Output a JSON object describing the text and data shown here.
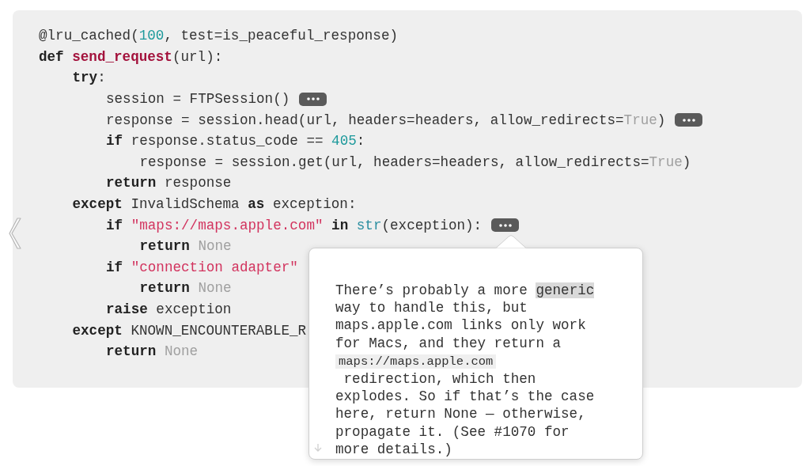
{
  "code": {
    "lines": [
      {
        "tokens": [
          {
            "kind": "plain",
            "text": "@lru_cached("
          },
          {
            "kind": "number",
            "text": "100"
          },
          {
            "kind": "plain",
            "text": ", test=is_peaceful_response)"
          }
        ],
        "has_more": false
      },
      {
        "tokens": [
          {
            "kind": "keyword",
            "text": "def "
          },
          {
            "kind": "function",
            "text": "send_request"
          },
          {
            "kind": "plain",
            "text": "(url):"
          }
        ],
        "has_more": false,
        "children": [
          {
            "tokens": [
              {
                "kind": "keyword",
                "text": "try"
              },
              {
                "kind": "plain",
                "text": ":"
              }
            ],
            "has_more": false,
            "children": [
              {
                "tokens": [
                  {
                    "kind": "plain",
                    "text": "session = FTPSession()"
                  }
                ],
                "has_more": true
              },
              {
                "tokens": [
                  {
                    "kind": "plain",
                    "text": "response = session.head(url, headers=headers, allow_redirects="
                  },
                  {
                    "kind": "constant",
                    "text": "True"
                  },
                  {
                    "kind": "plain",
                    "text": ")"
                  }
                ],
                "has_more": true
              },
              {
                "tokens": [
                  {
                    "kind": "keyword",
                    "text": "if "
                  },
                  {
                    "kind": "plain",
                    "text": "response.status_code == "
                  },
                  {
                    "kind": "number",
                    "text": "405"
                  },
                  {
                    "kind": "plain",
                    "text": ":"
                  }
                ],
                "has_more": false,
                "children": [
                  {
                    "tokens": [
                      {
                        "kind": "plain",
                        "text": "response = session.get(url, headers=headers, allow_redirects="
                      },
                      {
                        "kind": "constant",
                        "text": "True"
                      },
                      {
                        "kind": "plain",
                        "text": ")"
                      }
                    ],
                    "has_more": false
                  }
                ]
              },
              {
                "tokens": [
                  {
                    "kind": "keyword",
                    "text": "return "
                  },
                  {
                    "kind": "plain",
                    "text": "response"
                  }
                ],
                "has_more": false
              }
            ]
          },
          {
            "tokens": [
              {
                "kind": "keyword",
                "text": "except "
              },
              {
                "kind": "plain",
                "text": "InvalidSchema "
              },
              {
                "kind": "keyword",
                "text": "as "
              },
              {
                "kind": "plain",
                "text": "exception:"
              }
            ],
            "has_more": false,
            "children": [
              {
                "tokens": [
                  {
                    "kind": "keyword",
                    "text": "if "
                  },
                  {
                    "kind": "string",
                    "text": "\"maps://maps.apple.com\""
                  },
                  {
                    "kind": "keyword",
                    "text": " in "
                  },
                  {
                    "kind": "builtin",
                    "text": "str"
                  },
                  {
                    "kind": "plain",
                    "text": "(exception):"
                  }
                ],
                "has_more": true,
                "children": [
                  {
                    "tokens": [
                      {
                        "kind": "keyword",
                        "text": "return "
                      },
                      {
                        "kind": "constant",
                        "text": "None"
                      }
                    ],
                    "has_more": false
                  }
                ]
              },
              {
                "tokens": [
                  {
                    "kind": "keyword",
                    "text": "if "
                  },
                  {
                    "kind": "string",
                    "text": "\"connection adapter\""
                  }
                ],
                "has_more": false,
                "children": [
                  {
                    "tokens": [
                      {
                        "kind": "keyword",
                        "text": "return "
                      },
                      {
                        "kind": "constant",
                        "text": "None"
                      }
                    ],
                    "has_more": false
                  }
                ]
              },
              {
                "tokens": [
                  {
                    "kind": "keyword",
                    "text": "raise "
                  },
                  {
                    "kind": "plain",
                    "text": "exception"
                  }
                ],
                "has_more": false
              }
            ]
          },
          {
            "tokens": [
              {
                "kind": "keyword",
                "text": "except "
              },
              {
                "kind": "plain",
                "text": "KNOWN_ENCOUNTERABLE_R"
              }
            ],
            "has_more": false,
            "children": [
              {
                "tokens": [
                  {
                    "kind": "keyword",
                    "text": "return "
                  },
                  {
                    "kind": "constant",
                    "text": "None"
                  }
                ],
                "has_more": false
              }
            ]
          }
        ]
      }
    ]
  },
  "comment": {
    "lines": [
      [
        {
          "kind": "plain",
          "text": "There’s probably a more "
        },
        {
          "kind": "highlight",
          "text": "generic"
        }
      ],
      [
        {
          "kind": "plain",
          "text": "way to handle this, but"
        }
      ],
      [
        {
          "kind": "plain",
          "text": "maps.apple.com links only work"
        }
      ],
      [
        {
          "kind": "plain",
          "text": "for Macs, and they return a"
        }
      ],
      [
        {
          "kind": "code",
          "text": "maps://maps.apple.com"
        }
      ],
      [
        {
          "kind": "plain",
          "text": " redirection, which then"
        }
      ],
      [
        {
          "kind": "plain",
          "text": "explodes. So if that’s the case"
        }
      ],
      [
        {
          "kind": "plain",
          "text": "here, return None — otherwise,"
        }
      ],
      [
        {
          "kind": "plain",
          "text": "propagate it. (See #1070 for"
        }
      ],
      [
        {
          "kind": "plain",
          "text": "more details.)"
        }
      ]
    ]
  }
}
